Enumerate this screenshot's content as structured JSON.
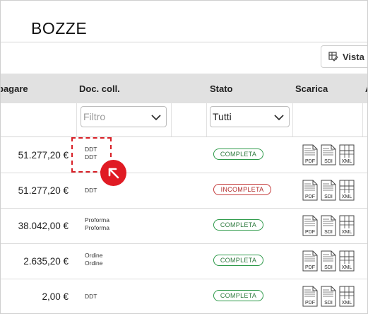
{
  "page": {
    "title": "BOZZE"
  },
  "toolbar": {
    "vista_label": "Vista d"
  },
  "table": {
    "headers": {
      "da_pagare": "pagare",
      "doc_coll": "Doc. coll.",
      "stato": "Stato",
      "scarica": "Scarica",
      "extra": "A"
    },
    "filters": {
      "doc_placeholder": "Filtro",
      "stato_value": "Tutti"
    },
    "rows": [
      {
        "amount": "51.277,20 €",
        "docs": [
          "DDT",
          "DDT"
        ],
        "status": "COMPLETA"
      },
      {
        "amount": "51.277,20 €",
        "docs": [
          "DDT"
        ],
        "status": "INCOMPLETA"
      },
      {
        "amount": "38.042,00 €",
        "docs": [
          "Proforma",
          "Proforma"
        ],
        "status": "COMPLETA"
      },
      {
        "amount": "2.635,20 €",
        "docs": [
          "Ordine",
          "Ordine"
        ],
        "status": "COMPLETA"
      },
      {
        "amount": "2,00 €",
        "docs": [
          "DDT"
        ],
        "status": "COMPLETA"
      }
    ],
    "download_labels": {
      "pdf": "PDF",
      "sdi": "SDI",
      "xml": "XML"
    }
  },
  "colors": {
    "complete": "#2e9a4a",
    "incomplete": "#c43b3b",
    "highlight": "#e01b24",
    "header_bg": "#e1e1e1"
  },
  "icons": {
    "vista": "table-edit-icon",
    "chevron": "chevron-down-icon",
    "cursor": "arrow-up-left-icon",
    "pdf": "pdf-file-icon",
    "sdi": "sdi-file-icon",
    "xml": "xml-file-icon"
  }
}
